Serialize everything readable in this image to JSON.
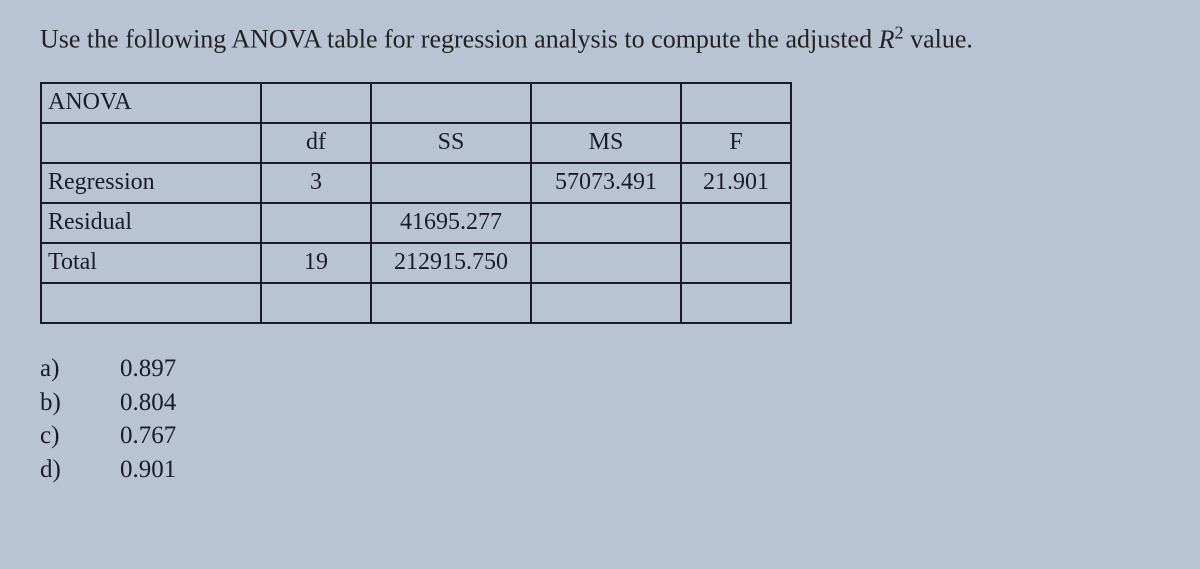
{
  "question_part1": "Use the following ANOVA table for regression analysis to compute the adjusted ",
  "question_r": "R",
  "question_sup": "2",
  "question_part2": " value.",
  "table": {
    "title": "ANOVA",
    "headers": {
      "df": "df",
      "ss": "SS",
      "ms": "MS",
      "f": "F"
    },
    "rows": [
      {
        "label": "Regression",
        "df": "3",
        "ss": "",
        "ms": "57073.491",
        "f": "21.901"
      },
      {
        "label": "Residual",
        "df": "",
        "ss": "41695.277",
        "ms": "",
        "f": ""
      },
      {
        "label": "Total",
        "df": "19",
        "ss": "212915.750",
        "ms": "",
        "f": ""
      }
    ]
  },
  "options": [
    {
      "label": "a)",
      "value": "0.897"
    },
    {
      "label": "b)",
      "value": "0.804"
    },
    {
      "label": "c)",
      "value": "0.767"
    },
    {
      "label": "d)",
      "value": "0.901"
    }
  ]
}
